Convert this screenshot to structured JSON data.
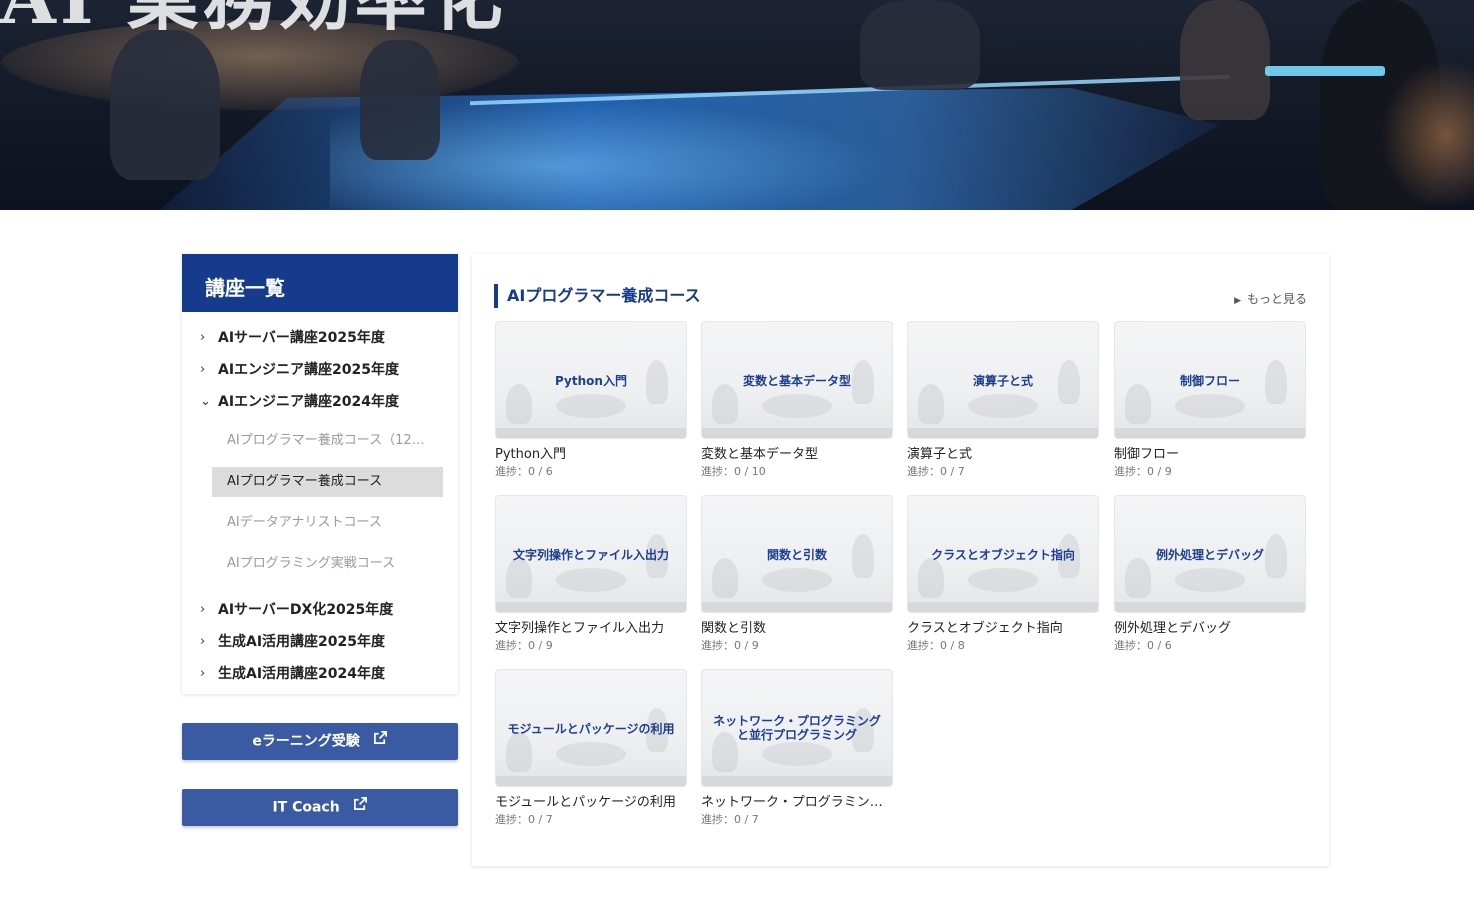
{
  "hero": {
    "title": "AI 業務効率化"
  },
  "sidebar": {
    "title": "講座一覧",
    "items": [
      {
        "label": "AIサーバー講座2025年度",
        "expanded": false
      },
      {
        "label": "AIエンジニア講座2025年度",
        "expanded": false
      },
      {
        "label": "AIエンジニア講座2024年度",
        "expanded": true,
        "children": [
          {
            "label": "AIプログラマー養成コース（12…"
          },
          {
            "label": "AIプログラマー養成コース",
            "active": true
          },
          {
            "label": "AIデータアナリストコース"
          },
          {
            "label": "AIプログラミング実戦コース"
          }
        ]
      },
      {
        "label": "AIサーバーDX化2025年度",
        "expanded": false
      },
      {
        "label": "生成AI活用講座2025年度",
        "expanded": false
      },
      {
        "label": "生成AI活用講座2024年度",
        "expanded": false
      }
    ]
  },
  "buttons": {
    "elearning": "eラーニング受験",
    "itcoach": "IT Coach"
  },
  "main": {
    "title": "AIプログラマー養成コース",
    "more": "もっと見る",
    "courses": [
      {
        "thumb": "Python入門",
        "title": "Python入門",
        "progress": "進捗：0 / 6"
      },
      {
        "thumb": "変数と基本データ型",
        "title": "変数と基本データ型",
        "progress": "進捗：0 / 10"
      },
      {
        "thumb": "演算子と式",
        "title": "演算子と式",
        "progress": "進捗：0 / 7"
      },
      {
        "thumb": "制御フロー",
        "title": "制御フロー",
        "progress": "進捗：0 / 9"
      },
      {
        "thumb": "文字列操作とファイル入出力",
        "title": "文字列操作とファイル入出力",
        "progress": "進捗：0 / 9"
      },
      {
        "thumb": "関数と引数",
        "title": "関数と引数",
        "progress": "進捗：0 / 9"
      },
      {
        "thumb": "クラスとオブジェクト指向",
        "title": "クラスとオブジェクト指向",
        "progress": "進捗：0 / 8"
      },
      {
        "thumb": "例外処理とデバッグ",
        "title": "例外処理とデバッグ",
        "progress": "進捗：0 / 6"
      },
      {
        "thumb": "モジュールとパッケージの利用",
        "title": "モジュールとパッケージの利用",
        "progress": "進捗：0 / 7"
      },
      {
        "thumb": "ネットワーク・プログラミング と並行プログラミング",
        "title": "ネットワーク・プログラミン…",
        "progress": "進捗：0 / 7"
      }
    ]
  }
}
